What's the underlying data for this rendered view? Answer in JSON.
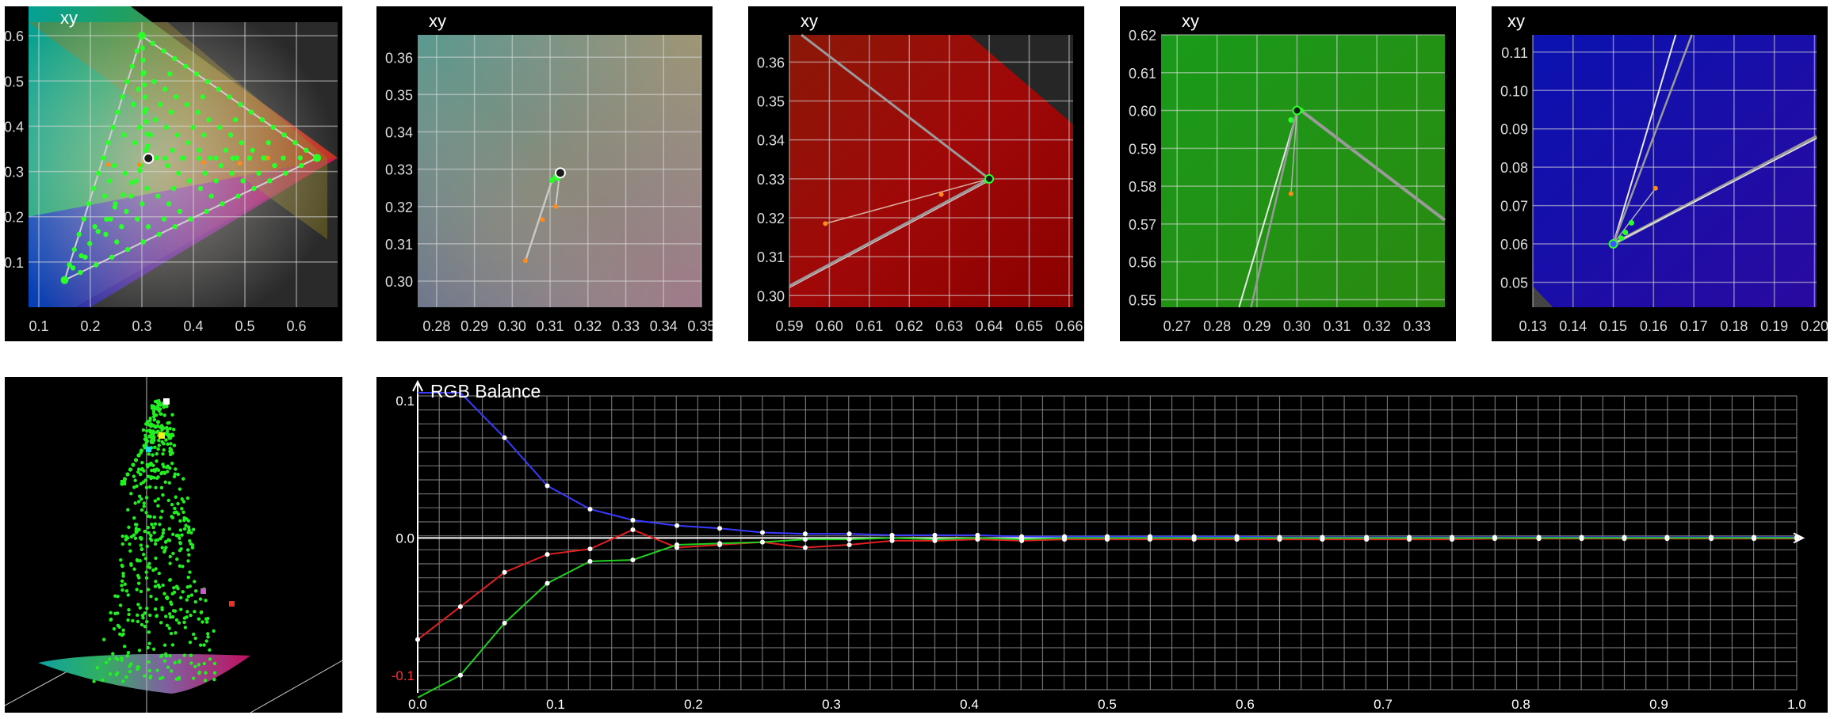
{
  "panels": [
    {
      "title": "xy"
    },
    {
      "title": "xy"
    },
    {
      "title": "xy"
    },
    {
      "title": "xy"
    },
    {
      "title": "xy"
    }
  ],
  "chart_data": [
    {
      "type": "scatter",
      "title": "xy",
      "xlim": [
        0.08,
        0.68
      ],
      "ylim": [
        0.0,
        0.63
      ],
      "xticks": [
        0.1,
        0.2,
        0.3,
        0.4,
        0.5,
        0.6
      ],
      "xtick_labels": [
        "0.1",
        "0.2",
        "0.3",
        "0.4",
        "0.5",
        "0.6"
      ],
      "yticks": [
        0.1,
        0.2,
        0.3,
        0.4,
        0.5,
        0.6
      ],
      "ytick_labels": [
        "0.1",
        "0.2",
        "0.3",
        "0.4",
        "0.5",
        "0.6"
      ],
      "gamut_triangle": [
        [
          0.64,
          0.33
        ],
        [
          0.3,
          0.6
        ],
        [
          0.15,
          0.06
        ]
      ],
      "white_point": [
        0.3127,
        0.329
      ],
      "orange_points": [
        [
          0.235,
          0.315
        ],
        [
          0.295,
          0.315
        ],
        [
          0.305,
          0.325
        ],
        [
          0.42,
          0.32
        ],
        [
          0.49,
          0.318
        ],
        [
          0.545,
          0.33
        ]
      ]
    },
    {
      "type": "scatter",
      "title": "xy",
      "xlim": [
        0.275,
        0.35
      ],
      "ylim": [
        0.293,
        0.366
      ],
      "xticks": [
        0.28,
        0.29,
        0.3,
        0.31,
        0.32,
        0.33,
        0.34,
        0.35
      ],
      "xtick_labels": [
        "0.28",
        "0.29",
        "0.30",
        "0.31",
        "0.32",
        "0.33",
        "0.34",
        "0.35"
      ],
      "yticks": [
        0.3,
        0.31,
        0.32,
        0.33,
        0.34,
        0.35,
        0.36
      ],
      "ytick_labels": [
        "0.30",
        "0.31",
        "0.32",
        "0.33",
        "0.34",
        "0.35",
        "0.36"
      ],
      "target": [
        0.3127,
        0.329
      ],
      "orange_points": [
        [
          0.3035,
          0.3055
        ],
        [
          0.308,
          0.3165
        ],
        [
          0.3115,
          0.32
        ]
      ],
      "green_points": [
        [
          0.3105,
          0.327
        ],
        [
          0.3115,
          0.328
        ],
        [
          0.312,
          0.3275
        ],
        [
          0.3125,
          0.3285
        ]
      ]
    },
    {
      "type": "scatter",
      "title": "xy",
      "xlim": [
        0.59,
        0.661
      ],
      "ylim": [
        0.297,
        0.367
      ],
      "xticks": [
        0.59,
        0.6,
        0.61,
        0.62,
        0.63,
        0.64,
        0.65,
        0.66
      ],
      "xtick_labels": [
        "0.59",
        "0.60",
        "0.61",
        "0.62",
        "0.63",
        "0.64",
        "0.65",
        "0.66"
      ],
      "yticks": [
        0.3,
        0.31,
        0.32,
        0.33,
        0.34,
        0.35,
        0.36
      ],
      "ytick_labels": [
        "0.30",
        "0.31",
        "0.32",
        "0.33",
        "0.34",
        "0.35",
        "0.36"
      ],
      "target": [
        0.64,
        0.33
      ],
      "orange_points": [
        [
          0.599,
          0.3185
        ],
        [
          0.628,
          0.326
        ]
      ],
      "green_points": [
        [
          0.6395,
          0.3295
        ],
        [
          0.6405,
          0.33
        ]
      ]
    },
    {
      "type": "scatter",
      "title": "xy",
      "xlim": [
        0.266,
        0.337
      ],
      "ylim": [
        0.548,
        0.62
      ],
      "xticks": [
        0.27,
        0.28,
        0.29,
        0.3,
        0.31,
        0.32,
        0.33
      ],
      "xtick_labels": [
        "0.27",
        "0.28",
        "0.29",
        "0.30",
        "0.31",
        "0.32",
        "0.33"
      ],
      "yticks": [
        0.55,
        0.56,
        0.57,
        0.58,
        0.59,
        0.6,
        0.61,
        0.62
      ],
      "ytick_labels": [
        "0.55",
        "0.56",
        "0.57",
        "0.58",
        "0.59",
        "0.60",
        "0.61",
        "0.62"
      ],
      "target": [
        0.3,
        0.6
      ],
      "orange_points": [
        [
          0.2985,
          0.578
        ]
      ],
      "green_points": [
        [
          0.2985,
          0.5975
        ],
        [
          0.3,
          0.5995
        ],
        [
          0.301,
          0.6
        ]
      ]
    },
    {
      "type": "scatter",
      "title": "xy",
      "xlim": [
        0.13,
        0.2005
      ],
      "ylim": [
        0.0435,
        0.1145
      ],
      "xticks": [
        0.13,
        0.14,
        0.15,
        0.16,
        0.17,
        0.18,
        0.19,
        0.2
      ],
      "xtick_labels": [
        "0.13",
        "0.14",
        "0.15",
        "0.16",
        "0.17",
        "0.18",
        "0.19",
        "0.20"
      ],
      "yticks": [
        0.05,
        0.06,
        0.07,
        0.08,
        0.09,
        0.1,
        0.11
      ],
      "ytick_labels": [
        "0.05",
        "0.06",
        "0.07",
        "0.08",
        "0.09",
        "0.10",
        "0.11"
      ],
      "target": [
        0.15,
        0.06
      ],
      "orange_points": [
        [
          0.1605,
          0.0745
        ]
      ],
      "green_points": [
        [
          0.1545,
          0.0655
        ],
        [
          0.153,
          0.063
        ],
        [
          0.152,
          0.0615
        ]
      ]
    },
    {
      "type": "line",
      "title": "RGB Balance",
      "xlim": [
        0.0,
        1.0
      ],
      "ylim": [
        -0.1,
        0.1
      ],
      "xticks": [
        0.0,
        0.1,
        0.2,
        0.3,
        0.4,
        0.5,
        0.6,
        0.7,
        0.8,
        0.9,
        1.0
      ],
      "xtick_labels": [
        "0.0",
        "0.1",
        "0.2",
        "0.3",
        "0.4",
        "0.5",
        "0.6",
        "0.7",
        "0.8",
        "0.9",
        "1.0"
      ],
      "ytick_labels": [
        "0.1",
        "0.0",
        "-0.1"
      ],
      "x": [
        0.0,
        0.031,
        0.063,
        0.094,
        0.125,
        0.156,
        0.188,
        0.219,
        0.25,
        0.281,
        0.313,
        0.344,
        0.375,
        0.406,
        0.438,
        0.469,
        0.5,
        0.531,
        0.563,
        0.594,
        0.625,
        0.656,
        0.688,
        0.719,
        0.75,
        0.781,
        0.813,
        0.844,
        0.875,
        0.906,
        0.938,
        0.969,
        1.0
      ],
      "series": [
        {
          "color": "#3a3aff",
          "values": [
            0.16,
            0.13,
            0.073,
            0.038,
            0.021,
            0.013,
            0.009,
            0.007,
            0.004,
            0.003,
            0.003,
            0.002,
            0.002,
            0.002,
            0.001,
            0.001,
            0.001,
            0.001,
            0.001,
            0.001,
            0.0005,
            0.0005,
            0.0005,
            0.0005,
            0.0005,
            0.0005,
            0.0005,
            0.0005,
            0.0005,
            0.0005,
            0.0005,
            0.0005,
            0.0005
          ]
        },
        {
          "color": "#e02020",
          "values": [
            -0.074,
            -0.05,
            -0.025,
            -0.012,
            -0.008,
            0.006,
            -0.007,
            -0.005,
            -0.003,
            -0.007,
            -0.005,
            -0.002,
            -0.002,
            -0.001,
            -0.002,
            -0.001,
            -0.001,
            -0.001,
            -0.001,
            -0.001,
            -0.001,
            -0.001,
            -0.001,
            -0.001,
            -0.001,
            -0.0005,
            -0.0005,
            -0.0005,
            -0.0005,
            -0.0005,
            -0.0005,
            -0.0005,
            -0.0005
          ]
        },
        {
          "color": "#20d020",
          "values": [
            -0.16,
            -0.1,
            -0.062,
            -0.033,
            -0.017,
            -0.016,
            -0.005,
            -0.004,
            -0.003,
            -0.001,
            -0.001,
            0.0,
            -0.001,
            0.0,
            -0.001,
            0.0,
            0.0,
            0.0,
            0.0,
            0.0,
            0.0,
            0.0,
            0.0,
            0.0,
            0.0,
            0.0,
            0.0,
            0.0,
            0.0,
            0.0,
            0.0,
            0.0,
            0.0
          ]
        }
      ]
    }
  ]
}
